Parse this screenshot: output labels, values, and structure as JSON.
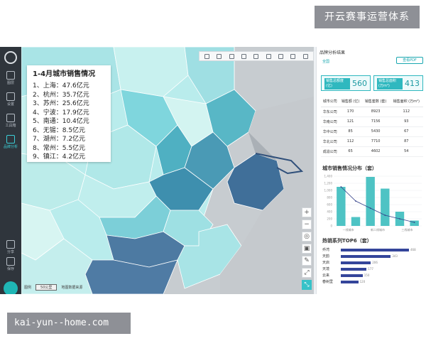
{
  "watermark": {
    "top": "开云赛事运营体系",
    "bottom": "kai-yun--home.com"
  },
  "sidebar": {
    "items": [
      {
        "label": "图层",
        "icon": "cube-icon"
      },
      {
        "label": "设置",
        "icon": "sliders-icon"
      },
      {
        "label": "工具箱",
        "icon": "toolbox-icon"
      },
      {
        "label": "品牌分析",
        "icon": "analysis-icon"
      },
      {
        "label": "分享",
        "icon": "share-icon"
      },
      {
        "label": "保存",
        "icon": "save-icon"
      }
    ]
  },
  "card": {
    "title": "1-4月城市销售情况",
    "items": [
      "1、上海：47.6亿元",
      "2、杭州：35.7亿元",
      "3、苏州：25.6亿元",
      "4、宁波：17.9亿元",
      "5、南通：10.4亿元",
      "6、无锡：8.5亿元",
      "7、湖州：7.2亿元",
      "8、常州：5.5亿元",
      "9、镇江：4.2亿元"
    ]
  },
  "map": {
    "scale_label": "50公里",
    "legend_label": "图例",
    "data_source": "地图数据来源"
  },
  "panel": {
    "header": "品牌分析结果",
    "link": "全国",
    "button": "查看PDF",
    "stats": [
      {
        "label": "销售总额度 (亿)",
        "value": "560"
      },
      {
        "label": "销售总面积 (万m²)",
        "value": "413"
      }
    ],
    "table": {
      "headers": [
        "城市公司",
        "销售额 (亿)",
        "销售套数 (套)",
        "销售面积 (万m²)"
      ],
      "rows": [
        [
          "华东公司",
          "170",
          "8923",
          "112"
        ],
        [
          "华南公司",
          "121",
          "7156",
          "93"
        ],
        [
          "华中公司",
          "85",
          "5430",
          "67"
        ],
        [
          "华北公司",
          "112",
          "7710",
          "87"
        ],
        [
          "成渝公司",
          "65",
          "4602",
          "54"
        ]
      ]
    },
    "chart_title": "城市销售情况分布（套）",
    "top_title": "热销系列TOP6（套）",
    "top_list": [
      {
        "name": "乔湾",
        "value": "468"
      },
      {
        "name": "天韵",
        "value": "343"
      },
      {
        "name": "天启",
        "value": "206"
      },
      {
        "name": "天境",
        "value": "177"
      },
      {
        "name": "云来",
        "value": "150"
      },
      {
        "name": "春树里",
        "value": "120"
      }
    ]
  },
  "chart_data": {
    "type": "bar",
    "title": "城市销售情况分布（套）",
    "categories": [
      "一线城市",
      "一线城市",
      "二线城市",
      "二线城市",
      "三线城市",
      "三线城市"
    ],
    "values": [
      1100,
      250,
      1380,
      1050,
      400,
      150
    ],
    "y_ticks": [
      "1,400",
      "1,200",
      "1,000",
      "800",
      "600",
      "400",
      "200",
      "0"
    ],
    "x_labels": [
      "一线城市",
      "新二线城市",
      "三线城市"
    ],
    "ylim": [
      0,
      1400
    ],
    "line": [
      1100,
      700,
      500,
      300,
      200,
      100
    ],
    "colors": {
      "bar": "#4ec3c4",
      "line": "#33408a"
    }
  },
  "colors": {
    "accent": "#2fb8bf",
    "dark_bar": "#34459a",
    "sidebar": "#2f353c"
  }
}
